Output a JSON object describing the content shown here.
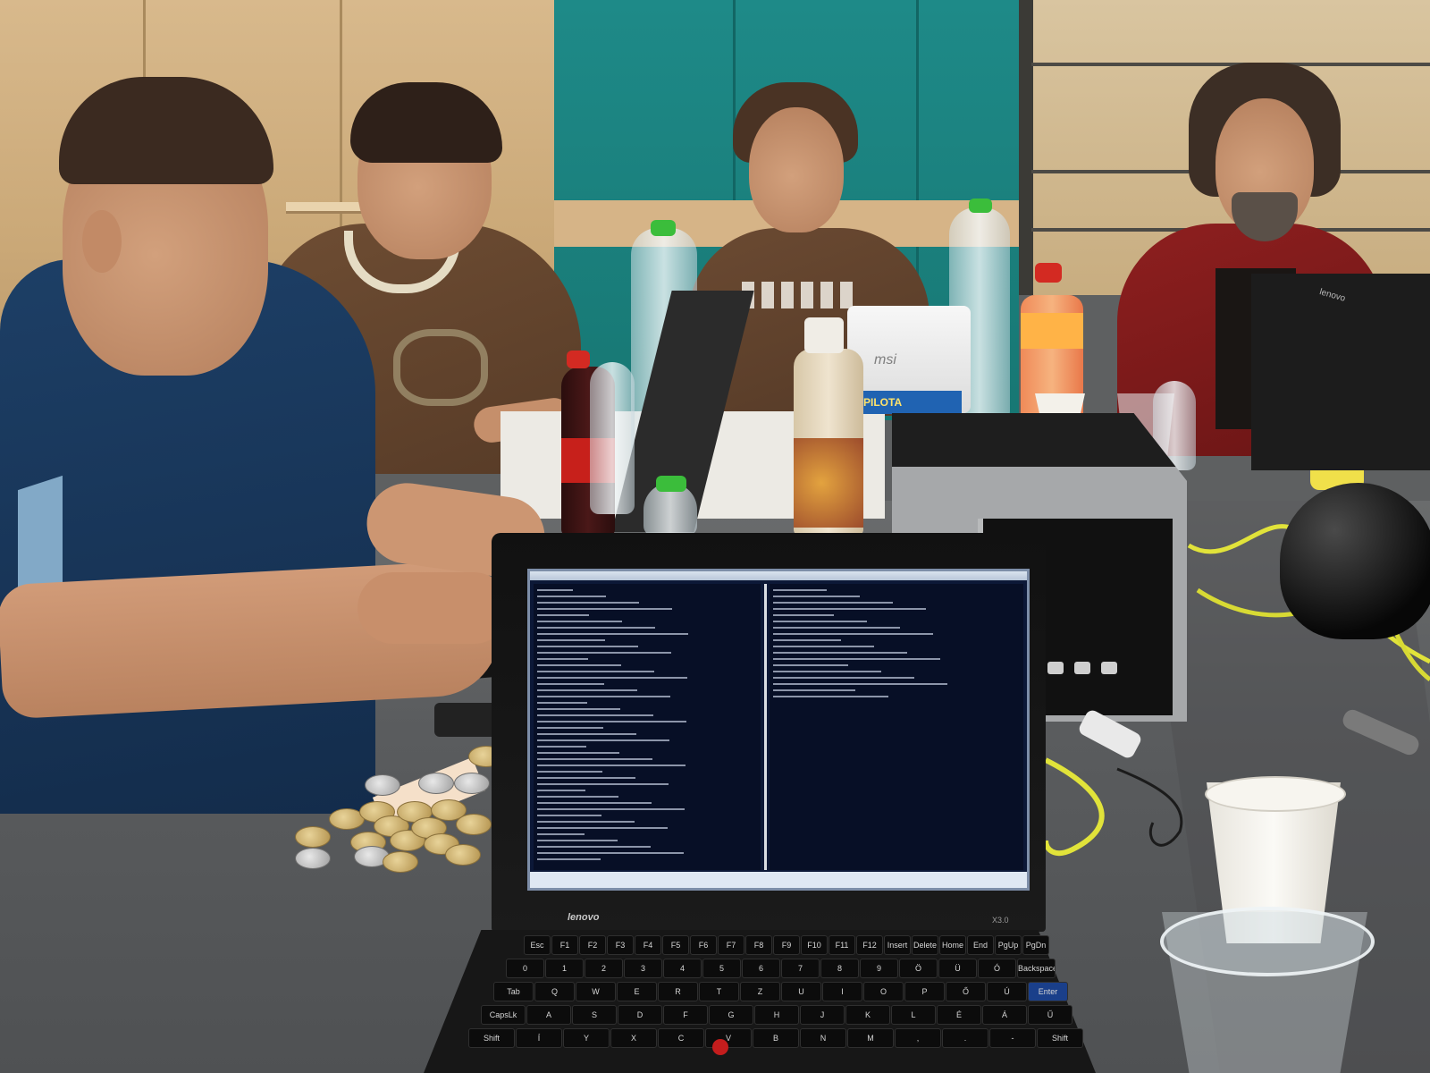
{
  "laptop_main": {
    "bezel_logo": "lenovo",
    "model": "X3.0",
    "screen_title_color": "#0c1837"
  },
  "laptop_back": {
    "brand": "msi",
    "snack_label": "PILOTA"
  },
  "laptop_right": {
    "brand": "lenovo"
  },
  "keyboard": {
    "rows": [
      [
        "Esc",
        "F1",
        "F2",
        "F3",
        "F4",
        "F5",
        "F6",
        "F7",
        "F8",
        "F9",
        "F10",
        "F11",
        "F12",
        "Insert",
        "Delete",
        "Home",
        "End",
        "PgUp",
        "PgDn"
      ],
      [
        "0",
        "1",
        "2",
        "3",
        "4",
        "5",
        "6",
        "7",
        "8",
        "9",
        "Ö",
        "Ü",
        "Ó",
        "Backspace"
      ],
      [
        "Tab",
        "Q",
        "W",
        "E",
        "R",
        "T",
        "Z",
        "U",
        "I",
        "O",
        "P",
        "Ő",
        "Ú",
        "Enter"
      ],
      [
        "CapsLk",
        "A",
        "S",
        "D",
        "F",
        "G",
        "H",
        "J",
        "K",
        "L",
        "É",
        "Á",
        "Ű"
      ],
      [
        "Shift",
        "Í",
        "Y",
        "X",
        "C",
        "V",
        "B",
        "N",
        "M",
        ",",
        ".",
        "-",
        "Shift"
      ]
    ]
  },
  "colors": {
    "wall_teal": "#1e8a88",
    "wall_wood": "#d8b98c",
    "table_gray": "#5f6163",
    "shirt_navy": "#1d3f66",
    "shirt_brown": "#6e4d33",
    "shirt_red": "#8e1f1f",
    "screen_navy": "#0c1837",
    "trackpoint_red": "#c41d1d"
  }
}
